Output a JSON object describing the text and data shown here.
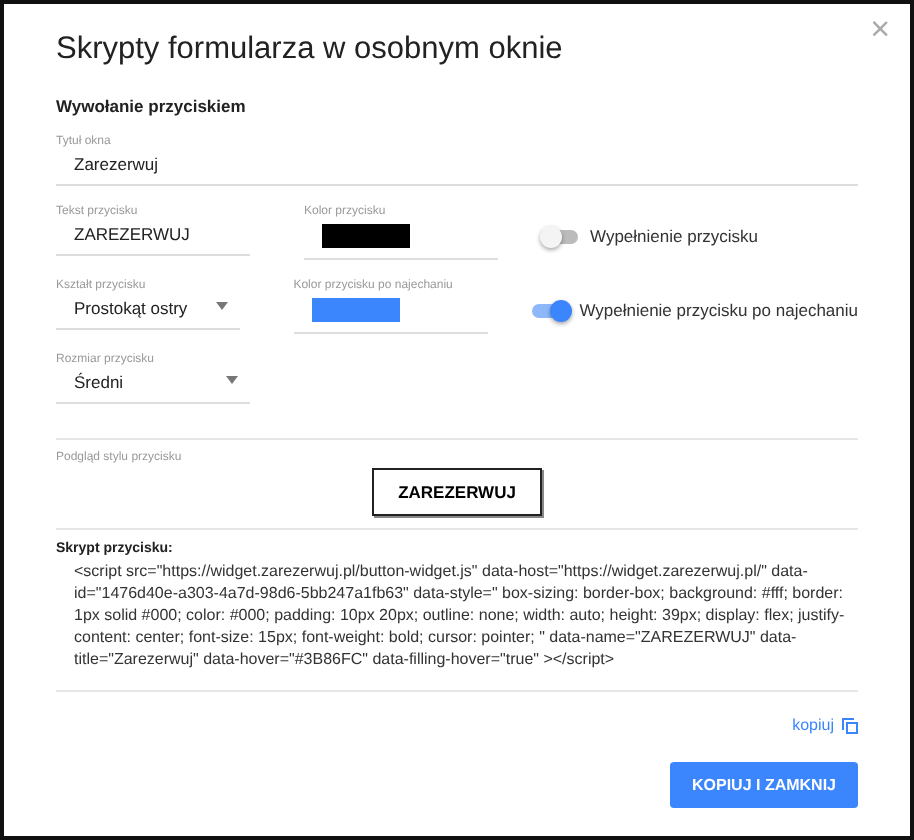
{
  "dialog": {
    "title": "Skrypty formularza w osobnym oknie",
    "close": "×",
    "section": "Wywołanie przyciskiem"
  },
  "title_field": {
    "label": "Tytuł okna",
    "value": "Zarezerwuj"
  },
  "rows": [
    {
      "field": {
        "kind": "text",
        "label": "Tekst przycisku",
        "value": "ZAREZERWUJ"
      },
      "color": {
        "label": "Kolor przycisku",
        "color": "#000000"
      },
      "toggle": {
        "label": "Wypełnienie przycisku",
        "on": false
      }
    },
    {
      "field": {
        "kind": "select",
        "label": "Kształt przycisku",
        "value": "Prostokąt ostry"
      },
      "color": {
        "label": "Kolor przycisku po najechaniu",
        "color": "#3b86fc"
      },
      "toggle": {
        "label": "Wypełnienie przycisku po najechaniu",
        "on": true
      }
    },
    {
      "field": {
        "kind": "select",
        "label": "Rozmiar przycisku",
        "value": "Średni"
      }
    }
  ],
  "preview": {
    "label": "Podgląd stylu przycisku",
    "button": "ZAREZERWUJ"
  },
  "script": {
    "label": "Skrypt przycisku:",
    "code": "<script src=\"https://widget.zarezerwuj.pl/button-widget.js\" data-host=\"https://widget.zarezerwuj.pl/\" data-id=\"1476d40e-a303-4a7d-98d6-5bb247a1fb63\" data-style=\" box-sizing: border-box; background: #fff; border: 1px solid #000; color: #000; padding: 10px 20px; outline: none; width: auto; height: 39px; display: flex; justify-content: center; font-size: 15px; font-weight: bold; cursor: pointer; \" data-name=\"ZAREZERWUJ\" data-title=\"Zarezerwuj\" data-hover=\"#3B86FC\" data-filling-hover=\"true\" ></script>"
  },
  "copy_link": "kopiuj",
  "submit": "KOPIUJ I ZAMKNIJ"
}
